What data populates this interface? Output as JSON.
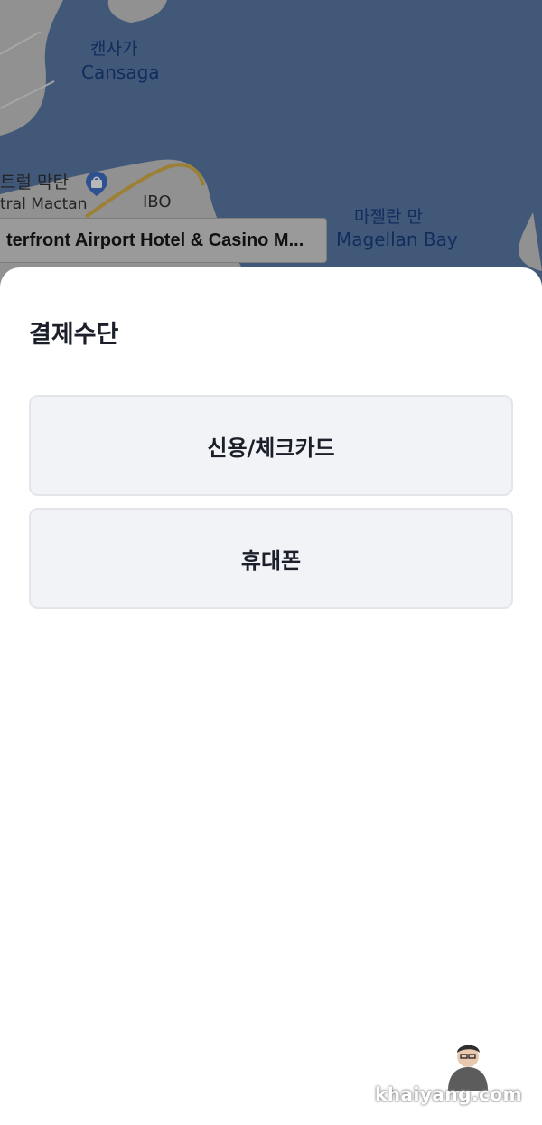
{
  "map": {
    "labels": {
      "cansaga_ko": "캔사가",
      "cansaga_en": "Cansaga",
      "central_mactan_ko": "트럴 막탄",
      "central_mactan_en": "tral Mactan",
      "ibo": "IBO",
      "magellan_ko": "마젤란 만",
      "magellan_en": "Magellan Bay"
    },
    "hotel_chip": "terfront Airport Hotel & Casino M...",
    "icons": [
      "shopping-pin-icon"
    ],
    "colors": {
      "water": "#3f5677",
      "land": "#7c7c7c",
      "road": "#b08c2a"
    }
  },
  "sheet": {
    "title": "결제수단",
    "methods": [
      {
        "label": "신용/체크카드"
      },
      {
        "label": "휴대폰"
      }
    ]
  },
  "watermark": {
    "text": "khaiyang.com"
  }
}
